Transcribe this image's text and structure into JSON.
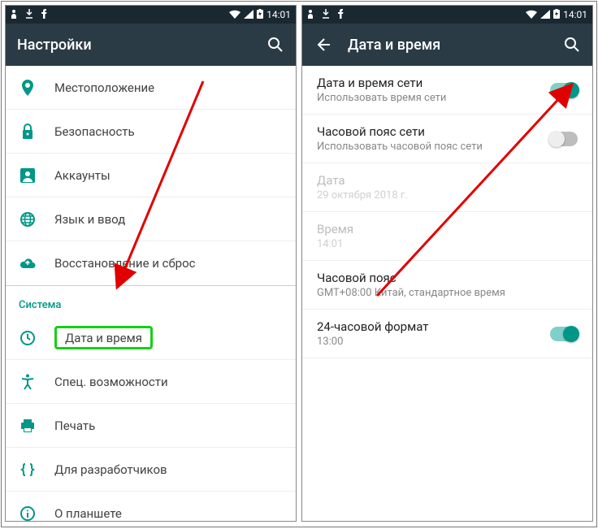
{
  "statusbar": {
    "time": "14:01"
  },
  "left": {
    "title": "Настройки",
    "items": [
      {
        "label": "Местоположение"
      },
      {
        "label": "Безопасность"
      },
      {
        "label": "Аккаунты"
      },
      {
        "label": "Язык и ввод"
      },
      {
        "label": "Восстановление и сброс"
      }
    ],
    "section": "Система",
    "system_items": [
      {
        "label": "Дата и время"
      },
      {
        "label": "Спец. возможности"
      },
      {
        "label": "Печать"
      },
      {
        "label": "Для разработчиков"
      },
      {
        "label": "О планшете"
      }
    ]
  },
  "right": {
    "title": "Дата и время",
    "settings": [
      {
        "primary": "Дата и время сети",
        "secondary": "Использовать время сети",
        "toggle": "on"
      },
      {
        "primary": "Часовой пояс сети",
        "secondary": "Использовать часовой пояс сети",
        "toggle": "off"
      },
      {
        "primary": "Дата",
        "secondary": "29 октября 2018 г.",
        "disabled": true
      },
      {
        "primary": "Время",
        "secondary": "14:01",
        "disabled": true
      },
      {
        "primary": "Часовой пояс",
        "secondary": "GMT+08:00 Китай, стандартное время"
      },
      {
        "primary": "24-часовой формат",
        "secondary": "13:00",
        "toggle": "on"
      }
    ]
  }
}
